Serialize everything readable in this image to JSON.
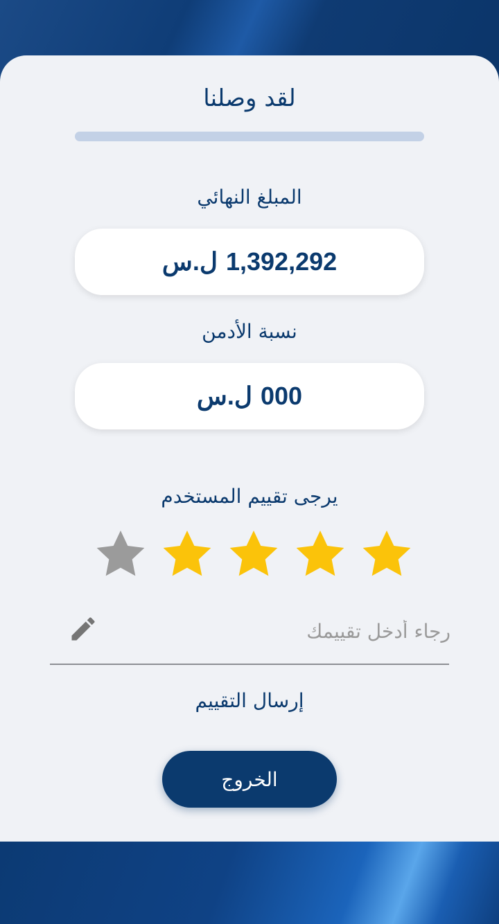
{
  "header": {
    "title": "لقد وصلنا",
    "progress": 1.0
  },
  "final_amount": {
    "label": "المبلغ النهائي",
    "value": "1,392,292",
    "currency": "ل.س"
  },
  "admin_share": {
    "label": "نسبة الأدمن",
    "value": "000",
    "currency": "ل.س"
  },
  "rating": {
    "prompt": "يرجى تقييم المستخدم",
    "value": 4,
    "max": 5,
    "filled_color": "#fbc30a",
    "empty_color": "#9b9b9b"
  },
  "review": {
    "placeholder": "رجاء أدخل تقييمك",
    "icon": "pencil-icon"
  },
  "submit": {
    "label": "إرسال التقييم"
  },
  "exit": {
    "label": "الخروج"
  },
  "colors": {
    "primary": "#0b3a6e",
    "card_bg": "#f0f2f6",
    "progress": "#c3d1e6"
  }
}
